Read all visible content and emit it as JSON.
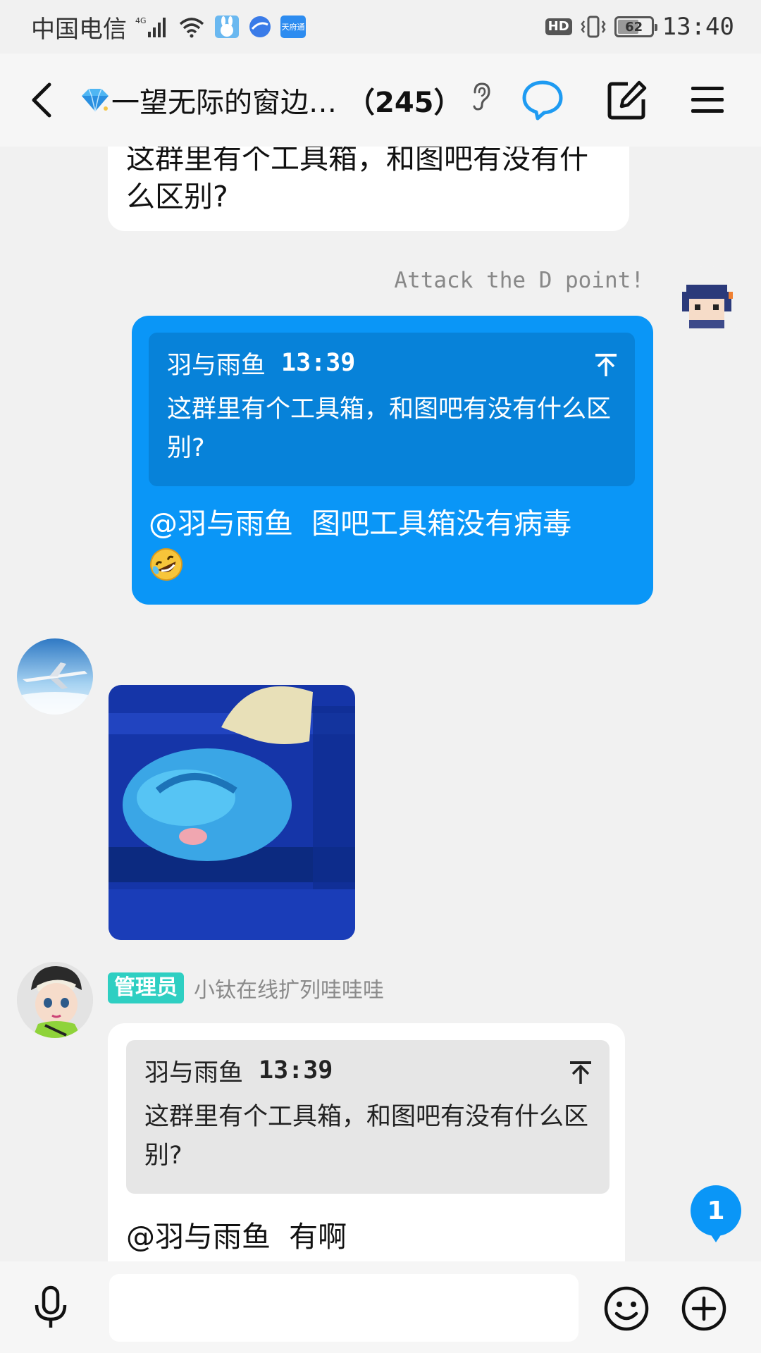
{
  "status_bar": {
    "carrier": "中国电信",
    "network": "4G",
    "app_badge": "天府通",
    "hd": "HD",
    "battery": "62",
    "battery_level": 0.62,
    "time": "13:40"
  },
  "header": {
    "group_name": "一望无际的窗边…",
    "member_count": "（245）",
    "icons": [
      "back-icon",
      "diamond-icon",
      "ear-icon",
      "chat-icon",
      "edit-icon",
      "menu-icon"
    ]
  },
  "messages": {
    "prev_text": "这群里有个工具箱，和图吧有没有什么区别?",
    "me": {
      "nickname": "Attack the D point!",
      "quote_author": "羽与雨鱼",
      "quote_time": "13:39",
      "quote_text": "这群里有个工具箱，和图吧有没有什么区别?",
      "mention": "@羽与雨鱼",
      "text": "图吧工具箱没有病毒"
    },
    "admin": {
      "role": "管理员",
      "name": "小钛在线扩列哇哇哇",
      "quote_author": "羽与雨鱼",
      "quote_time": "13:39",
      "quote_text": "这群里有个工具箱，和图吧有没有什么区别?",
      "mention": "@羽与雨鱼",
      "text": "有啊"
    }
  },
  "unread_count": "1",
  "input": {
    "placeholder": ""
  },
  "colors": {
    "accent": "#0a96f7",
    "admin_tag": "#2ecfc2",
    "background": "#f1f1f1"
  }
}
